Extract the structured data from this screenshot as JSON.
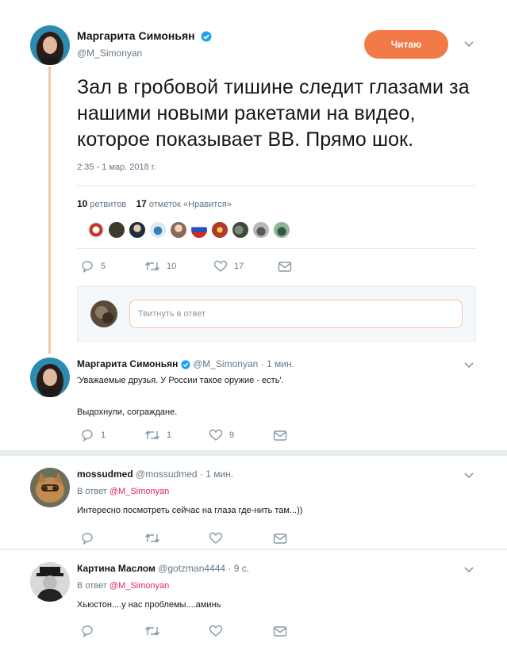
{
  "main_tweet": {
    "name": "Маргарита Симоньян",
    "handle": "@M_Simonyan",
    "follow_label": "Читаю",
    "text": "Зал в гробовой тишине следит глазами за нашими новыми ракетами на видео, которое показывает ВВ. Прямо шок.",
    "timestamp": "2:35 - 1 мар. 2018 г.",
    "retweets_count": "10",
    "retweets_label": "ретвитов",
    "likes_count": "17",
    "likes_label": "отметок «Нравится»",
    "actions": {
      "replies": "5",
      "retweets": "10",
      "likes": "17"
    },
    "reply_placeholder": "Твитнуть в ответ"
  },
  "replies": [
    {
      "name": "Маргарита Симоньян",
      "handle": "@M_Simonyan",
      "separator": "·",
      "time": "1 мин.",
      "line1": "'Уважаемые друзья. У России такое оружие - есть'.",
      "line2": "Выдохнули, сограждане.",
      "actions": {
        "replies": "1",
        "retweets": "1",
        "likes": "9"
      }
    },
    {
      "name": "mossudmed",
      "handle": "@mossudmed",
      "separator": "·",
      "time": "1 мин.",
      "reply_to_label": "В ответ",
      "reply_to_handle": "@M_Simonyan",
      "line1": "Интересно посмотреть сейчас на глаза где-нить там...))"
    },
    {
      "name": "Картина Маслом",
      "handle": "@gotzman4444",
      "separator": "·",
      "time": "9 с.",
      "reply_to_label": "В ответ",
      "reply_to_handle": "@M_Simonyan",
      "line1": "Хьюстон....у нас проблемы....аминь"
    }
  ],
  "colors": {
    "accent": "#f27a46",
    "thread_line": "#f5c6a9",
    "mention": "#e0245e",
    "muted": "#657786",
    "background": "#e6ecf0"
  },
  "icons": [
    "reply-icon",
    "retweet-icon",
    "like-icon",
    "message-icon",
    "verified-icon",
    "chevron-down-icon"
  ]
}
